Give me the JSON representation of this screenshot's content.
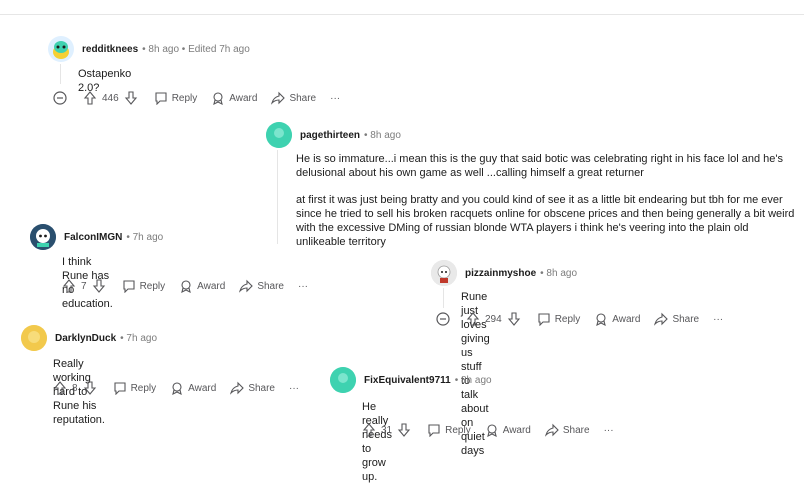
{
  "comments": [
    {
      "user": "redditknees",
      "meta": "• 8h ago • Edited 7h ago",
      "body": "Ostapenko 2.0?",
      "votes": "446",
      "actions": {
        "reply": "Reply",
        "award": "Award",
        "share": "Share",
        "more": "···"
      }
    },
    {
      "user": "pagethirteen",
      "meta": "• 8h ago",
      "body": "He is so immature...i mean this is the guy that said botic was celebrating right in his face lol and he's delusional about his own game as well ...calling himself a great returner",
      "body2": "at first it was just being bratty and you could kind of see it as a little bit endearing but tbh for me ever since he tried to sell his broken racquets online for obscene prices and then being generally a bit weird with the excessive DMing of russian blonde WTA players i think he's veering into the plain old unlikeable territory"
    },
    {
      "user": "FalconIMGN",
      "meta": "• 7h ago",
      "body": "I think Rune has no education.",
      "votes": "7",
      "actions": {
        "reply": "Reply",
        "award": "Award",
        "share": "Share",
        "more": "···"
      }
    },
    {
      "user": "pizzainmyshoe",
      "meta": "• 8h ago",
      "body": "Rune just loves giving us stuff to talk about on quiet days",
      "votes": "294",
      "actions": {
        "reply": "Reply",
        "award": "Award",
        "share": "Share",
        "more": "···"
      }
    },
    {
      "user": "DarklynDuck",
      "meta": "• 7h ago",
      "body": "Really working hard to Rune his reputation.",
      "votes": "8",
      "actions": {
        "reply": "Reply",
        "award": "Award",
        "share": "Share",
        "more": "···"
      }
    },
    {
      "user": "FixEquivalent9711",
      "meta": "• 8h ago",
      "body": "He really needs to grow up.",
      "votes": "31",
      "actions": {
        "reply": "Reply",
        "award": "Award",
        "share": "Share",
        "more": "···"
      }
    }
  ],
  "colors": {
    "avatar_teal": "#3ed2b0",
    "avatar_yellow": "#f2c94c",
    "avatar_blue": "#1f4e79",
    "avatar_gray": "#d9d9d9",
    "text": "#1c1c1c",
    "meta": "#7c7c7c"
  }
}
